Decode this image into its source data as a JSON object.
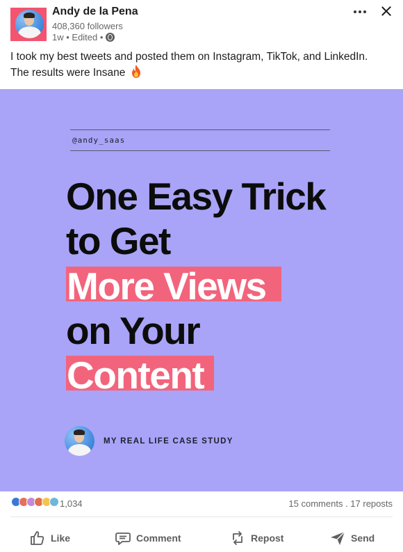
{
  "author": {
    "name": "Andy de la Pena",
    "followers": "408,360 followers",
    "timestamp": "1w • Edited •"
  },
  "post": {
    "text": "I took my best tweets and posted them on Instagram, TikTok, and LinkedIn. The results were Insane"
  },
  "card": {
    "handle": "@andy_saas",
    "headline": {
      "line1": "One Easy Trick",
      "line2": "to Get",
      "line3": "More Views",
      "line4": "on Your",
      "line5": "Content"
    },
    "footer_text": "MY REAL LIFE CASE STUDY",
    "colors": {
      "background": "#a9a4f7",
      "highlight": "#f2647c",
      "text": "#0c0c0c"
    }
  },
  "engagement": {
    "reaction_count": "1,034",
    "comments_reposts": "15 comments . 17 reposts",
    "reaction_icons": [
      "like-icon",
      "celebrate-icon",
      "support-icon",
      "love-icon",
      "insightful-icon",
      "funny-icon"
    ]
  },
  "actions": {
    "like": "Like",
    "comment": "Comment",
    "repost": "Repost",
    "send": "Send"
  }
}
